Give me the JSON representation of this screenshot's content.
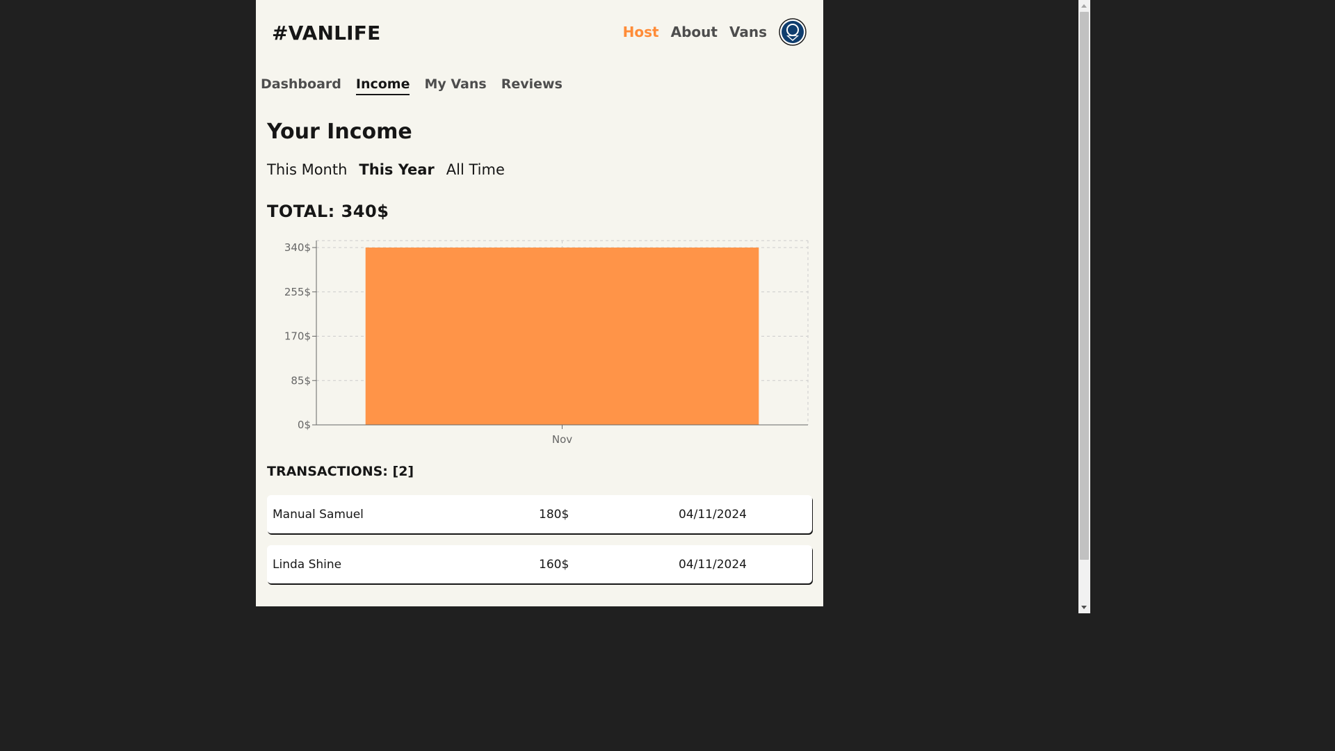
{
  "header": {
    "logo": "#VANLIFE",
    "nav": [
      {
        "label": "Host",
        "active": true
      },
      {
        "label": "About",
        "active": false
      },
      {
        "label": "Vans",
        "active": false
      }
    ],
    "avatar_icon": "user-avatar-icon"
  },
  "host_nav": {
    "tabs": [
      {
        "label": "Dashboard",
        "active": false
      },
      {
        "label": "Income",
        "active": true
      },
      {
        "label": "My Vans",
        "active": false
      },
      {
        "label": "Reviews",
        "active": false
      }
    ]
  },
  "income": {
    "title": "Your Income",
    "filters": [
      {
        "label": "This Month",
        "active": false
      },
      {
        "label": "This Year",
        "active": true
      },
      {
        "label": "All Time",
        "active": false
      }
    ],
    "total_label": "TOTAL: 340$"
  },
  "chart_data": {
    "type": "bar",
    "categories": [
      "Nov"
    ],
    "values": [
      340
    ],
    "y_ticks": [
      0,
      85,
      170,
      255,
      340
    ],
    "y_tick_labels": [
      "0$",
      "85$",
      "170$",
      "255$",
      "340$"
    ],
    "ylim": [
      0,
      340
    ],
    "bar_color": "#ff9448",
    "grid": true
  },
  "transactions": {
    "title": "TRANSACTIONS: [2]",
    "items": [
      {
        "name": "Manual Samuel",
        "amount": "180$",
        "date": "04/11/2024"
      },
      {
        "name": "Linda Shine",
        "amount": "160$",
        "date": "04/11/2024"
      }
    ]
  },
  "colors": {
    "accent": "#ff8c38",
    "page_bg": "#f6f5ee",
    "outer_bg": "#202020"
  }
}
